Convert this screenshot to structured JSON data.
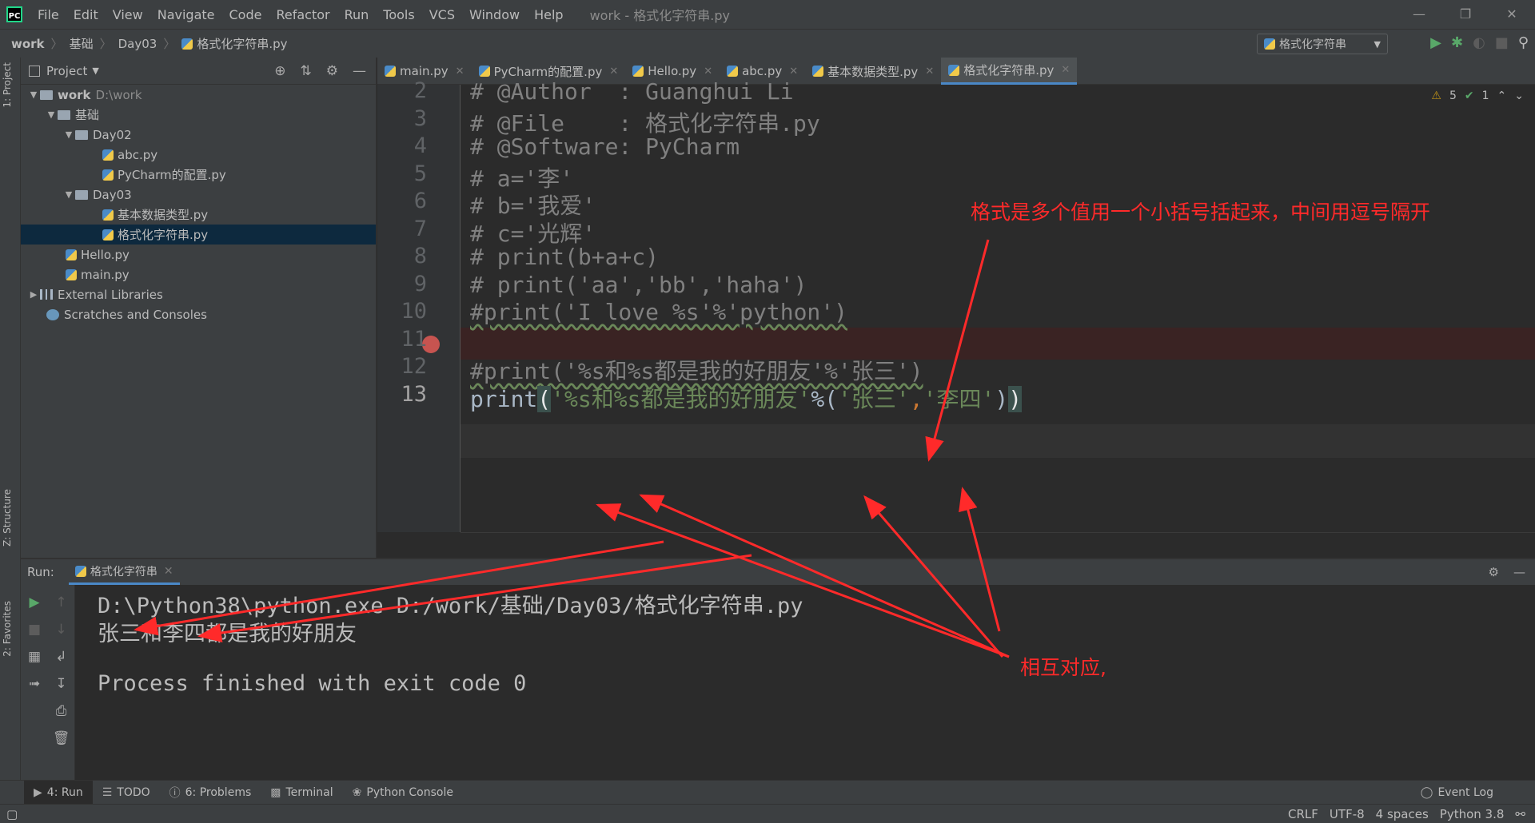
{
  "menubar": {
    "items": [
      "File",
      "Edit",
      "View",
      "Navigate",
      "Code",
      "Refactor",
      "Run",
      "Tools",
      "VCS",
      "Window",
      "Help"
    ],
    "window_title": "work - 格式化字符串.py"
  },
  "breadcrumb": [
    "work",
    "基础",
    "Day03",
    "格式化字符串.py"
  ],
  "run_config": "格式化字符串",
  "project_panel": {
    "title": "Project",
    "tree": [
      {
        "label": "work",
        "extra": "D:\\work",
        "depth": 0,
        "kind": "folder",
        "expanded": true
      },
      {
        "label": "基础",
        "depth": 1,
        "kind": "folder",
        "expanded": true
      },
      {
        "label": "Day02",
        "depth": 2,
        "kind": "folder",
        "expanded": true
      },
      {
        "label": "abc.py",
        "depth": 3,
        "kind": "py"
      },
      {
        "label": "PyCharm的配置.py",
        "depth": 3,
        "kind": "py"
      },
      {
        "label": "Day03",
        "depth": 2,
        "kind": "folder",
        "expanded": true
      },
      {
        "label": "基本数据类型.py",
        "depth": 3,
        "kind": "py"
      },
      {
        "label": "格式化字符串.py",
        "depth": 3,
        "kind": "py",
        "selected": true
      },
      {
        "label": "Hello.py",
        "depth": 2,
        "kind": "py"
      },
      {
        "label": "main.py",
        "depth": 2,
        "kind": "py"
      },
      {
        "label": "External Libraries",
        "depth": 0,
        "kind": "lib",
        "collapsed": true
      },
      {
        "label": "Scratches and Consoles",
        "depth": 0,
        "kind": "scratch"
      }
    ]
  },
  "editor_tabs": [
    {
      "label": "main.py",
      "active": false
    },
    {
      "label": "PyCharm的配置.py",
      "active": false
    },
    {
      "label": "Hello.py",
      "active": false
    },
    {
      "label": "abc.py",
      "active": false
    },
    {
      "label": "基本数据类型.py",
      "active": false
    },
    {
      "label": "格式化字符串.py",
      "active": true
    }
  ],
  "editor": {
    "warnings": "5",
    "ok": "1",
    "line_numbers": [
      "2",
      "3",
      "4",
      "5",
      "6",
      "7",
      "8",
      "9",
      "10",
      "11",
      "12",
      "13"
    ],
    "lines": {
      "l2": "# @Author  : Guanghui Li",
      "l3": "# @File    : 格式化字符串.py",
      "l4": "# @Software: PyCharm",
      "l5": "# a='李'",
      "l6": "# b='我爱'",
      "l7": "# c='光辉'",
      "l8": "# print(b+a+c)",
      "l9": "# print('aa','bb','haha')",
      "l10": "#print('I love %s'%'python')",
      "l11": "",
      "l12": "#print('%s和%s都是我的好朋友'%'张三')",
      "l13_fn": "print",
      "l13_open": "(",
      "l13_fmt": "'%s和%s都是我的好朋友'",
      "l13_pct": "%(",
      "l13_a": "'张三'",
      "l13_comma": ",",
      "l13_b": "'李四'",
      "l13_close1": ")",
      "l13_close2": ")"
    }
  },
  "run_panel": {
    "label": "Run:",
    "tab": "格式化字符串",
    "output": [
      "D:\\Python38\\python.exe D:/work/基础/Day03/格式化字符串.py",
      "张三和李四都是我的好朋友",
      "",
      "Process finished with exit code 0"
    ]
  },
  "left_strip": {
    "project": "1: Project",
    "structure": "Z: Structure",
    "favorites": "2: Favorites"
  },
  "bottom_tabs": [
    {
      "label": "4: Run",
      "active": true
    },
    {
      "label": "TODO",
      "active": false
    },
    {
      "label": "6: Problems",
      "active": false
    },
    {
      "label": "Terminal",
      "active": false
    },
    {
      "label": "Python Console",
      "active": false
    }
  ],
  "event_log": "Event Log",
  "status": {
    "line_sep": "CRLF",
    "encoding": "UTF-8",
    "indent": "4 spaces",
    "interpreter": "Python 3.8"
  },
  "annotations": {
    "top": "格式是多个值用一个小括号括起来，中间用逗号隔开",
    "bottom": "相互对应,"
  },
  "colors": {
    "annotation": "#ff2a2a",
    "accent": "#4a88c7",
    "run_green": "#59a869"
  }
}
